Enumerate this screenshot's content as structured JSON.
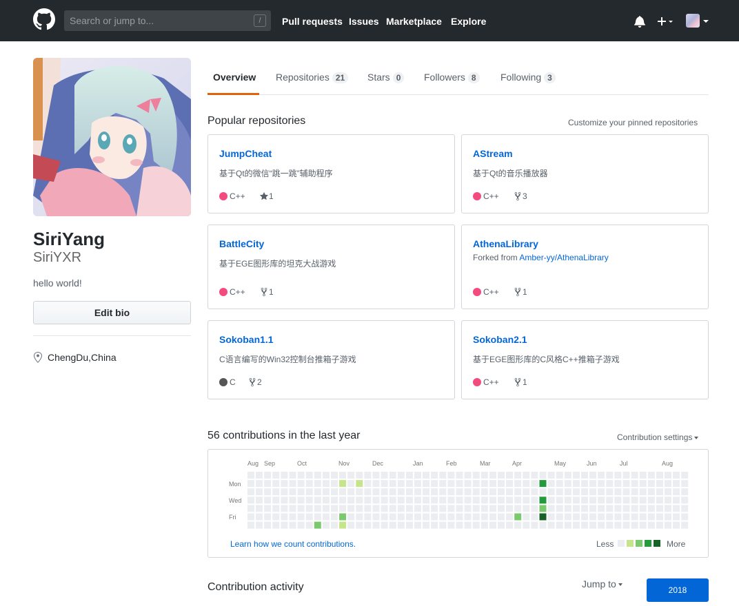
{
  "header": {
    "logo_icon": "github-mark-icon",
    "search_placeholder": "Search or jump to...",
    "search_shortcut": "/",
    "nav": [
      "Pull requests",
      "Issues",
      "Marketplace",
      "Explore"
    ],
    "notifications_icon": "bell-icon",
    "create_icon": "plus-icon",
    "avatar_icon": "avatar-icon"
  },
  "profile": {
    "full_name": "SiriYang",
    "login": "SiriYXR",
    "bio": "hello world!",
    "edit_bio_label": "Edit bio",
    "location": "ChengDu,China",
    "location_icon": "location-pin-icon"
  },
  "tabs": [
    {
      "label": "Overview",
      "count": null,
      "selected": true
    },
    {
      "label": "Repositories",
      "count": "21",
      "selected": false
    },
    {
      "label": "Stars",
      "count": "0",
      "selected": false
    },
    {
      "label": "Followers",
      "count": "8",
      "selected": false
    },
    {
      "label": "Following",
      "count": "3",
      "selected": false
    }
  ],
  "popular": {
    "title": "Popular repositories",
    "customize_label": "Customize your pinned repositories",
    "repos": [
      {
        "name": "JumpCheat",
        "description": "基于Qt的微信“跳一跳”辅助程序",
        "forked_from_prefix": "",
        "forked_from": "",
        "language": "C++",
        "language_color": "#f34b7d",
        "stat_icon": "star-icon",
        "stat": "1"
      },
      {
        "name": "AStream",
        "description": "基于Qt的音乐播放器",
        "forked_from_prefix": "",
        "forked_from": "",
        "language": "C++",
        "language_color": "#f34b7d",
        "stat_icon": "fork-icon",
        "stat": "3"
      },
      {
        "name": "BattleCity",
        "description": "基于EGE图形库的坦克大战游戏",
        "forked_from_prefix": "",
        "forked_from": "",
        "language": "C++",
        "language_color": "#f34b7d",
        "stat_icon": "fork-icon",
        "stat": "1"
      },
      {
        "name": "AthenaLibrary",
        "description": "",
        "forked_from_prefix": "Forked from",
        "forked_from": "Amber-yy/AthenaLibrary",
        "language": "C++",
        "language_color": "#f34b7d",
        "stat_icon": "fork-icon",
        "stat": "1"
      },
      {
        "name": "Sokoban1.1",
        "description": "C语言编写的Win32控制台推箱子游戏",
        "forked_from_prefix": "",
        "forked_from": "",
        "language": "C",
        "language_color": "#555555",
        "stat_icon": "fork-icon",
        "stat": "2"
      },
      {
        "name": "Sokoban2.1",
        "description": "基于EGE图形库的C风格C++推箱子游戏",
        "forked_from_prefix": "",
        "forked_from": "",
        "language": "C++",
        "language_color": "#f34b7d",
        "stat_icon": "fork-icon",
        "stat": "1"
      }
    ]
  },
  "contributions": {
    "title": "56 contributions in the last year",
    "settings_label": "Contribution settings",
    "months": [
      "Aug",
      "Sep",
      "Oct",
      "Nov",
      "Dec",
      "Jan",
      "Feb",
      "Mar",
      "Apr",
      "May",
      "Jun",
      "Jul",
      "Aug"
    ],
    "weekday_labels": [
      "Mon",
      "Wed",
      "Fri"
    ],
    "learn_link": "Learn how we count contributions.",
    "legend_less": "Less",
    "legend_more": "More",
    "level_colors": [
      "#ebedf0",
      "#c6e48b",
      "#7bc96f",
      "#239a3b",
      "#196127"
    ],
    "active_days": [
      {
        "week": 11,
        "day": 1,
        "level": 1
      },
      {
        "week": 13,
        "day": 1,
        "level": 1
      },
      {
        "week": 8,
        "day": 6,
        "level": 2
      },
      {
        "week": 11,
        "day": 5,
        "level": 2
      },
      {
        "week": 11,
        "day": 6,
        "level": 1
      },
      {
        "week": 13,
        "day": 7,
        "level": 2
      },
      {
        "week": 32,
        "day": 5,
        "level": 2
      },
      {
        "week": 35,
        "day": 1,
        "level": 3
      },
      {
        "week": 35,
        "day": 3,
        "level": 3
      },
      {
        "week": 35,
        "day": 4,
        "level": 2
      },
      {
        "week": 35,
        "day": 5,
        "level": 4
      },
      {
        "week": 35,
        "day": 7,
        "level": 2
      }
    ]
  },
  "activity": {
    "title": "Contribution activity",
    "jump_to_label": "Jump to",
    "year": "2018"
  }
}
